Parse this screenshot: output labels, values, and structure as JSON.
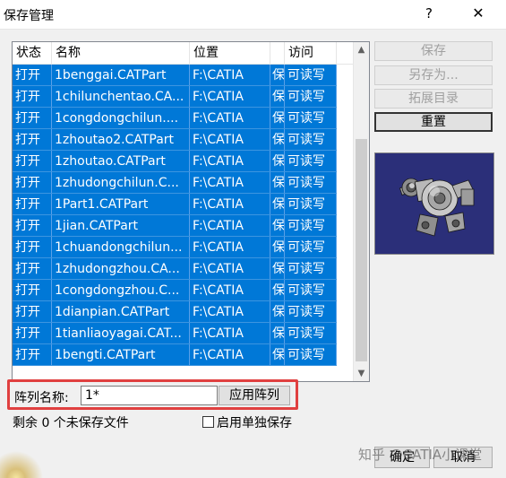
{
  "window": {
    "title": "保存管理",
    "help_glyph": "?",
    "close_glyph": "✕"
  },
  "table": {
    "columns": [
      "状态",
      "名称",
      "位置",
      "",
      "访问"
    ],
    "rows": [
      {
        "status": "打开",
        "name": "1benggai.CATPart",
        "location": "F:\\CATIA",
        "type": "保",
        "access": "可读写"
      },
      {
        "status": "打开",
        "name": "1chilunchentao.CA...",
        "location": "F:\\CATIA",
        "type": "保",
        "access": "可读写"
      },
      {
        "status": "打开",
        "name": "1congdongchilun....",
        "location": "F:\\CATIA",
        "type": "保",
        "access": "可读写"
      },
      {
        "status": "打开",
        "name": "1zhoutao2.CATPart",
        "location": "F:\\CATIA",
        "type": "保",
        "access": "可读写"
      },
      {
        "status": "打开",
        "name": "1zhoutao.CATPart",
        "location": "F:\\CATIA",
        "type": "保",
        "access": "可读写"
      },
      {
        "status": "打开",
        "name": "1zhudongchilun.C...",
        "location": "F:\\CATIA",
        "type": "保",
        "access": "可读写"
      },
      {
        "status": "打开",
        "name": "1Part1.CATPart",
        "location": "F:\\CATIA",
        "type": "保",
        "access": "可读写"
      },
      {
        "status": "打开",
        "name": "1jian.CATPart",
        "location": "F:\\CATIA",
        "type": "保",
        "access": "可读写"
      },
      {
        "status": "打开",
        "name": "1chuandongchilun...",
        "location": "F:\\CATIA",
        "type": "保",
        "access": "可读写"
      },
      {
        "status": "打开",
        "name": "1zhudongzhou.CA...",
        "location": "F:\\CATIA",
        "type": "保",
        "access": "可读写"
      },
      {
        "status": "打开",
        "name": "1congdongzhou.C...",
        "location": "F:\\CATIA",
        "type": "保",
        "access": "可读写"
      },
      {
        "status": "打开",
        "name": "1dianpian.CATPart",
        "location": "F:\\CATIA",
        "type": "保",
        "access": "可读写"
      },
      {
        "status": "打开",
        "name": "1tianliaoyagai.CAT...",
        "location": "F:\\CATIA",
        "type": "保",
        "access": "可读写"
      },
      {
        "status": "打开",
        "name": "1bengti.CATPart",
        "location": "F:\\CATIA",
        "type": "保",
        "access": "可读写"
      }
    ]
  },
  "buttons": {
    "save": "保存",
    "save_as": "另存为...",
    "extend_dir": "拓展目录",
    "reset": "重置",
    "ok": "确定",
    "cancel": "取消"
  },
  "array": {
    "label": "阵列名称:",
    "value": "1*",
    "apply": "应用阵列"
  },
  "status": {
    "remaining": "剩余 0 个未保存文件",
    "independent_save": "启用单独保存"
  },
  "watermark": "知乎 @CATIA小课堂",
  "colors": {
    "selection": "#0078d7",
    "highlight_border": "#e04040",
    "preview_bg": "#2b2f79"
  }
}
